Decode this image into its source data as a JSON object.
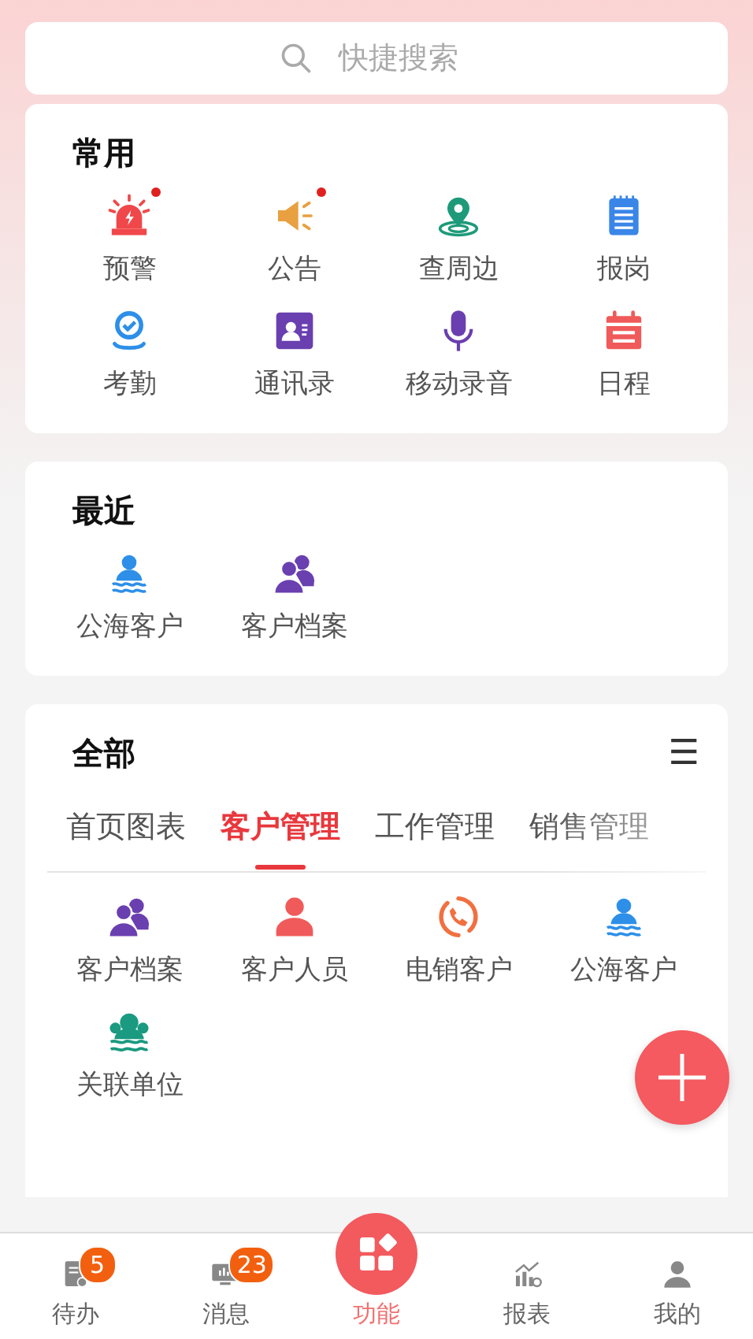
{
  "search": {
    "placeholder": "快捷搜索"
  },
  "common": {
    "title": "常用",
    "items": [
      {
        "label": "预警",
        "kind": "alarm",
        "dot": true
      },
      {
        "label": "公告",
        "kind": "megaphone",
        "dot": true
      },
      {
        "label": "查周边",
        "kind": "location",
        "dot": false
      },
      {
        "label": "报岗",
        "kind": "notepad",
        "dot": false
      },
      {
        "label": "考勤",
        "kind": "checkpin",
        "dot": false
      },
      {
        "label": "通讯录",
        "kind": "contact",
        "dot": false
      },
      {
        "label": "移动录音",
        "kind": "mic",
        "dot": false
      },
      {
        "label": "日程",
        "kind": "calendar",
        "dot": false
      }
    ]
  },
  "recent": {
    "title": "最近",
    "items": [
      {
        "label": "公海客户",
        "kind": "swimmer",
        "dot": false
      },
      {
        "label": "客户档案",
        "kind": "people",
        "dot": false
      }
    ]
  },
  "all": {
    "title": "全部",
    "menu": "☰",
    "tabs": [
      {
        "label": "首页图表",
        "selected": false
      },
      {
        "label": "客户管理",
        "selected": true
      },
      {
        "label": "工作管理",
        "selected": false
      },
      {
        "label": "销售管理",
        "selected": false
      }
    ],
    "items": [
      {
        "label": "客户档案",
        "kind": "people",
        "dot": false
      },
      {
        "label": "客户人员",
        "kind": "person",
        "dot": false
      },
      {
        "label": "电销客户",
        "kind": "phone",
        "dot": false
      },
      {
        "label": "公海客户",
        "kind": "swimmer",
        "dot": false
      },
      {
        "label": "关联单位",
        "kind": "groupwaves",
        "dot": false
      }
    ]
  },
  "nav": {
    "items": [
      {
        "label": "待办",
        "kind": "doc",
        "badge": "5",
        "selected": false
      },
      {
        "label": "消息",
        "kind": "monitor",
        "badge": "23",
        "selected": false
      },
      {
        "label": "功能",
        "kind": "grid",
        "selected": true
      },
      {
        "label": "报表",
        "kind": "chart",
        "selected": false
      },
      {
        "label": "我的",
        "kind": "user",
        "selected": false
      }
    ]
  }
}
